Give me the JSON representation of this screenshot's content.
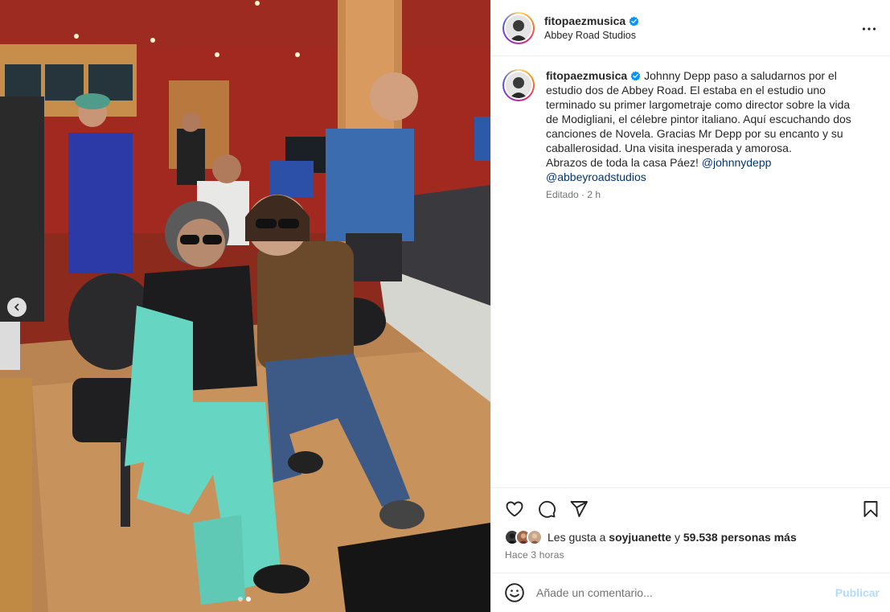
{
  "post": {
    "username": "fitopaezmusica",
    "location": "Abbey Road Studios",
    "caption_lines": [
      "Johnny Depp paso a saludarnos por el",
      "estudio dos de Abbey Road. El estaba en el estudio uno",
      "terminado su primer largometraje como director sobre la vida",
      "de Modigliani, el célebre pintor italiano. Aquí escuchando dos",
      "canciones de Novela. Gracias Mr Depp por su encanto y su",
      "caballerosidad. Una visita inesperada y amorosa.",
      "Abrazos de toda la casa Páez!"
    ],
    "mention_1": "@johnnydepp",
    "mention_2": "@abbeyroadstudios",
    "edited": "Editado · 2 h",
    "likes_prefix": "Les gusta a",
    "likes_user": "soyjuanette",
    "likes_and": "y",
    "likes_count": "59.538 personas más",
    "time_ago": "Hace 3 horas",
    "comment_placeholder": "Añade un comentario...",
    "publish_label": "Publicar"
  },
  "carousel": {
    "total": 2,
    "active": 2
  },
  "icons": {
    "verified": "verified-badge-icon",
    "more": "more-options-icon",
    "like": "heart-icon",
    "comment": "comment-bubble-icon",
    "share": "paper-plane-icon",
    "save": "bookmark-icon",
    "emoji": "smiley-icon",
    "prev": "chevron-left-icon"
  },
  "colors": {
    "verified_blue": "#0095f6",
    "mention": "#00376b",
    "muted": "#737373",
    "publish_disabled": "#b3dbff"
  }
}
